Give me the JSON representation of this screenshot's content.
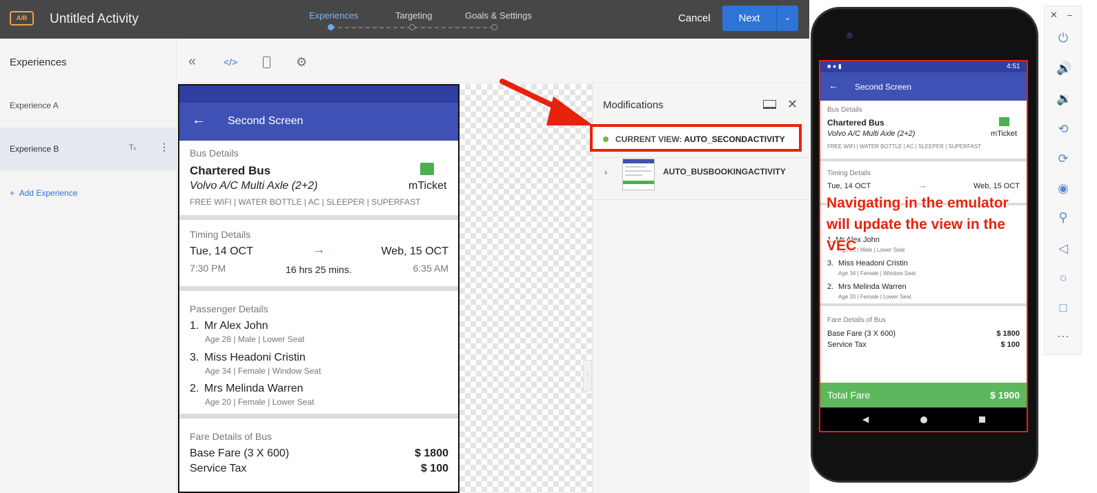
{
  "topbar": {
    "badge": "A/B",
    "activity_title": "Untitled Activity",
    "steps": [
      "Experiences",
      "Targeting",
      "Goals & Settings"
    ],
    "cancel_label": "Cancel",
    "next_label": "Next",
    "next_dropdown_icon": "chevron-down-icon"
  },
  "left_panel": {
    "heading": "Experiences",
    "experiences": [
      "Experience A",
      "Experience B"
    ],
    "add_label": "Add Experience"
  },
  "toolbar": {
    "icons": [
      "collapse-icon",
      "code-icon",
      "device-icon",
      "gear-icon"
    ]
  },
  "preview": {
    "app_title": "Second Screen",
    "bus": {
      "section": "Bus Details",
      "name": "Chartered Bus",
      "model": "Volvo A/C Multi Axle (2+2)",
      "features": "FREE WIFI | WATER BOTTLE | AC | SLEEPER | SUPERFAST",
      "ticket": "mTicket"
    },
    "timing": {
      "section": "Timing Details",
      "from_date": "Tue, 14 OCT",
      "to_date": "Web, 15 OCT",
      "from_time": "7:30 PM",
      "duration": "16 hrs 25 mins.",
      "to_time": "6:35 AM"
    },
    "passengers": {
      "section": "Passenger Details",
      "list": [
        {
          "num": "1.",
          "name": "Mr Alex John",
          "info": "Age 28 | Male | Lower Seat"
        },
        {
          "num": "3.",
          "name": "Miss Headoni Cristin",
          "info": "Age 34 | Female | Window Seat"
        },
        {
          "num": "2.",
          "name": "Mrs Melinda Warren",
          "info": "Age 20 | Female | Lower Seat"
        }
      ]
    },
    "fare": {
      "section": "Fare Details of Bus",
      "base_label": "Base Fare (3 X 600)",
      "base_value": "$ 1800",
      "tax_label": "Service Tax",
      "tax_value": "$ 100"
    }
  },
  "modifications": {
    "title": "Modifications",
    "current_view_prefix": "CURRENT VIEW:",
    "current_view_name": "AUTO_SECONDACTIVITY",
    "activity": "AUTO_BUSBOOKINGACTIVITY"
  },
  "emulator": {
    "time": "4:51",
    "app_title": "Second Screen",
    "bus_section": "Bus Details",
    "bus_name": "Chartered Bus",
    "bus_model": "Volvo A/C Multi Axle (2+2)",
    "ticket": "mTicket",
    "features": "FREE WIFI | WATER BOTTLE | AC | SLEEPER | SUPERFAST",
    "timing_section": "Timing Details",
    "from_date": "Tue, 14 OCT",
    "to_date": "Web, 15 OCT",
    "p1_partial": "1. Mr Alex John",
    "p1_info_partial": "Age 28 | Male | Lower Seat",
    "p3_num": "3.",
    "p3_name": "Miss Headoni Cristin",
    "p3_info": "Age 34 | Female | Window Seat",
    "p2_num": "2.",
    "p2_name": "Mrs Melinda Warren",
    "p2_info": "Age 20 | Female | Lower Seat",
    "fare_section": "Fare Details of Bus",
    "base_label": "Base Fare (3 X 600)",
    "base_value": "$ 1800",
    "tax_label": "Service Tax",
    "tax_value": "$ 100",
    "total_label": "Total Fare",
    "total_value": "$ 1900"
  },
  "annotation": "Navigating in the emulator will update the view in the VEC",
  "colors": {
    "accent_red": "#e8210c",
    "app_blue": "#3f51b5",
    "button_blue": "#2d74d6",
    "green": "#4caf50"
  }
}
